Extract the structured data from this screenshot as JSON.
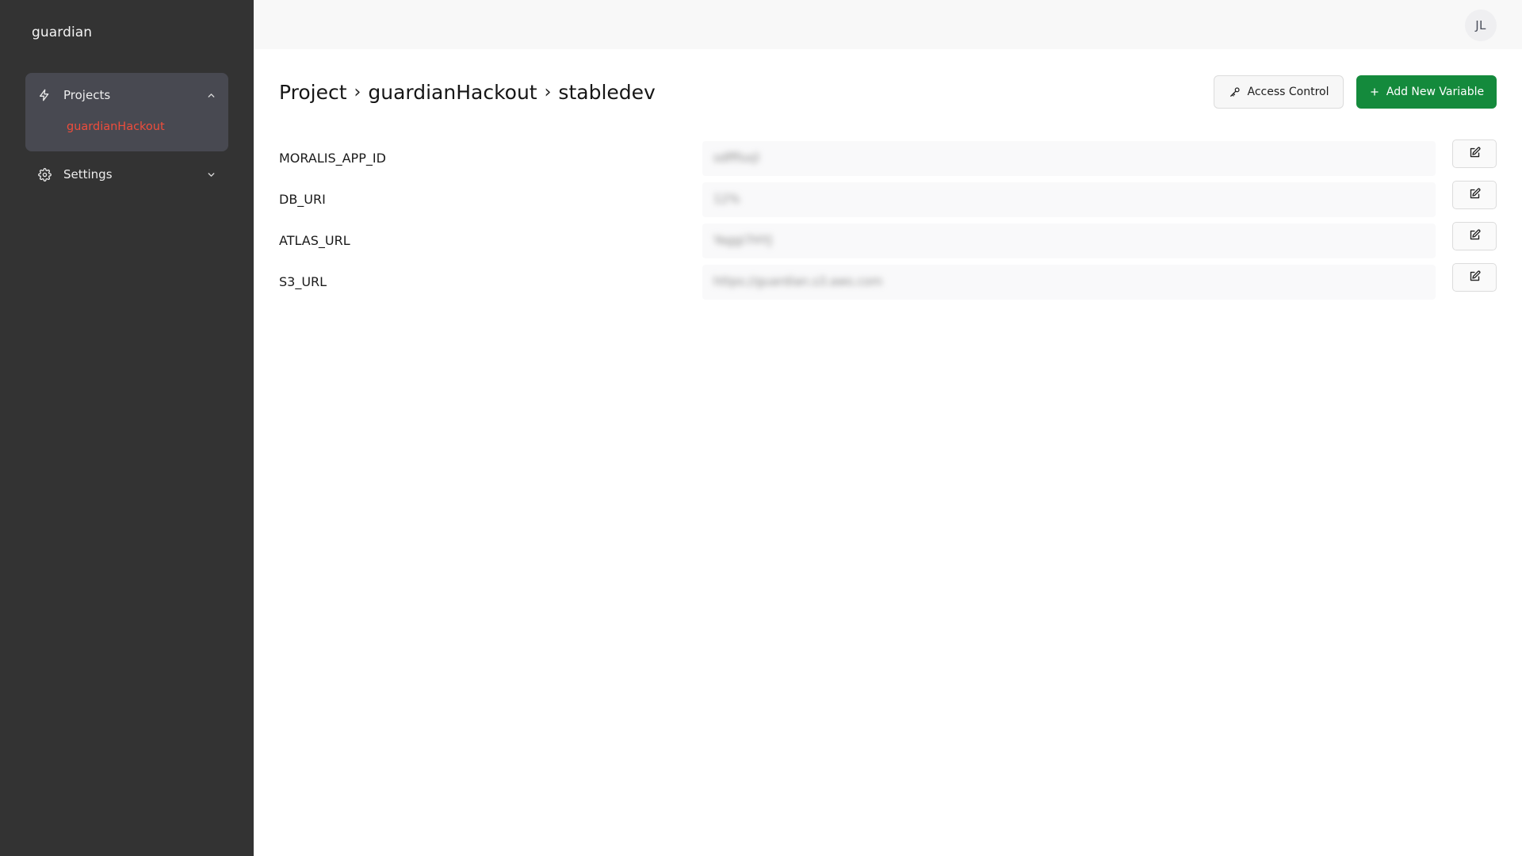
{
  "sidebar": {
    "brand": "guardian",
    "projects_label": "Projects",
    "projects_items": [
      "guardianHackout"
    ],
    "settings_label": "Settings"
  },
  "topbar": {
    "avatar_initials": "JL"
  },
  "header": {
    "breadcrumb": [
      "Project",
      "guardianHackout",
      "stabledev"
    ],
    "separator": "›"
  },
  "actions": {
    "access_control_label": "Access Control",
    "add_variable_label": "Add New Variable"
  },
  "variables": [
    {
      "name": "MORALIS_APP_ID",
      "value": "sdfffsxjl"
    },
    {
      "name": "DB_URI",
      "value": "12%"
    },
    {
      "name": "ATLAS_URL",
      "value": "Yaggi7HYJ"
    },
    {
      "name": "S3_URL",
      "value": "https://guardian.s3.aws.com"
    }
  ],
  "icons": {
    "projects": "bolt-icon",
    "projects_chevron": "chevron-up-icon",
    "settings": "gear-icon",
    "settings_chevron": "chevron-down-icon",
    "access": "key-icon",
    "add": "plus-icon",
    "edit": "edit-icon"
  },
  "colors": {
    "sidebar_bg": "#333333",
    "active_group_bg": "#484951",
    "active_item": "#ef4d3c",
    "primary_button": "#148a3c"
  }
}
